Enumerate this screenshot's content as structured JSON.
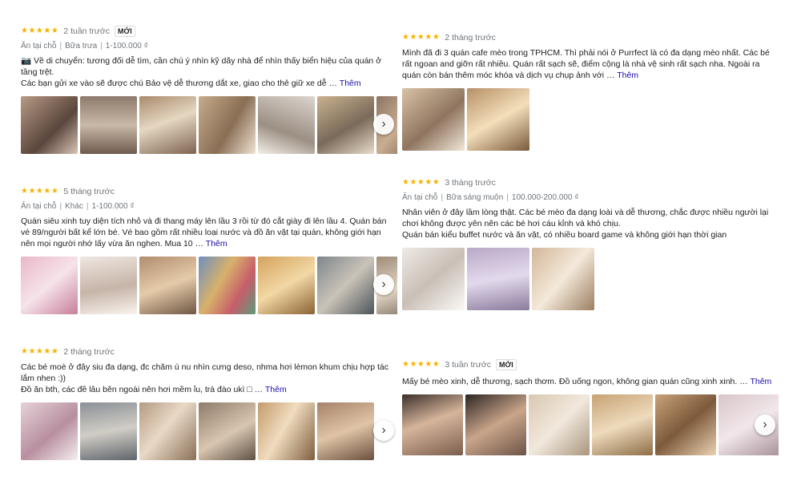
{
  "reviews": [
    {
      "stars": "★★★★★",
      "time": "2 tuần trước",
      "badge": "MỚI",
      "details": [
        "Ăn tại chỗ",
        "Bữa trưa",
        "1-100.000 ₫"
      ],
      "text_lines": [
        "📷 Về di chuyển: tương đối dễ tìm, cần chú ý nhìn kỹ dãy nhà để nhìn thấy biển hiệu của quán ở tầng trệt.",
        "Các bạn gửi xe vào sẽ được chú Bảo vệ dễ thương dắt xe, giao cho thẻ giữ xe dễ …"
      ],
      "more": "Thêm",
      "photo_count": 7,
      "has_next": true
    },
    {
      "stars": "★★★★★",
      "time": "5 tháng trước",
      "details": [
        "Ăn tại chỗ",
        "Khác",
        "1-100.000 ₫"
      ],
      "text_lines": [
        "Quán siêu xinh tuy diện tích nhỏ và đi thang máy lên lầu 3 rồi từ đó cắt giày đi lên lầu 4. Quán bán vé 89/người bất kể lớn bé. Vé bao gồm rất nhiều loại nước và đồ ăn vặt tại quán, không giới hạn nên mọi người nhớ lấy vừa ăn nghen. Mua 10 …"
      ],
      "more": "Thêm",
      "photo_count": 7,
      "has_next": true
    },
    {
      "stars": "★★★★★",
      "time": "2 tháng trước",
      "text_lines": [
        "Các bé moè ở đây siu đa dạng, đc chăm ú nu nhìn cưng deso, nhma hơi lèmon khum chịu hợp tác lắm nhen :))",
        "Đồ ăn bth, các đề lâu bên ngoài nên hơi mềm ỉu, trà đào ukì □ …"
      ],
      "more": "Thêm",
      "photo_count": 6,
      "has_next": true
    },
    {
      "stars": "★★★★★",
      "time": "2 tháng trước",
      "text_lines": [
        "Mình đã đi 3 quán cafe mèo trong TPHCM. Thì phải nói ở Purrfect là có đa dạng mèo nhất. Các bé rất ngoan and giỡn rất nhiều. Quán rất sạch sẽ, điểm cộng là nhà vệ sinh rất sạch nha. Ngoài ra quán còn bán thêm móc khóa và dịch vụ chụp ảnh với …"
      ],
      "more": "Thêm",
      "photo_count": 2,
      "has_next": false
    },
    {
      "stars": "★★★★★",
      "time": "3 tháng trước",
      "details": [
        "Ăn tại chỗ",
        "Bữa sáng muộn",
        "100.000-200.000 ₫"
      ],
      "text_lines": [
        "Nhân viên ở đây lầm lòng thật. Các bé mèo đa dạng loài và dễ thương, chắc được nhiều người lại chơi không được yên nên các bé hơi cáu kỉnh và khó chịu.",
        "Quán bán kiểu buffet nước và ăn vặt, có nhiều board game và không giới hạn thời gian"
      ],
      "photo_count": 3,
      "has_next": false
    },
    {
      "stars": "★★★★★",
      "time": "3 tuần trước",
      "badge": "MỚI",
      "text_lines": [
        "Mấy bé mèo xinh, dễ thương, sạch thơm. Đồ uống ngon, không gian quán cũng xinh xinh. …"
      ],
      "more": "Thêm",
      "photo_count": 6,
      "has_next": true
    }
  ],
  "colors": {
    "star": "#f4b400",
    "link": "#1a0dab",
    "muted": "#70757a"
  }
}
